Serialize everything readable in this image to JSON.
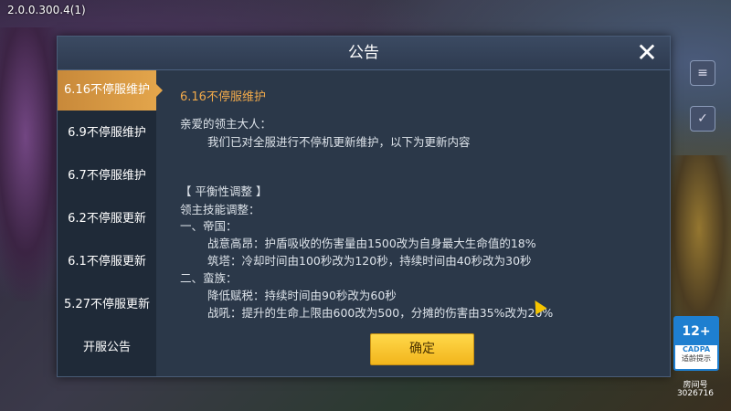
{
  "version": "2.0.0.300.4(1)",
  "dialog": {
    "title": "公告",
    "close_icon": "close-icon",
    "confirm_label": "确定"
  },
  "tabs": [
    {
      "label": "6.16不停服维护",
      "active": true
    },
    {
      "label": "6.9不停服维护",
      "active": false
    },
    {
      "label": "6.7不停服维护",
      "active": false
    },
    {
      "label": "6.2不停服更新",
      "active": false
    },
    {
      "label": "6.1不停服更新",
      "active": false
    },
    {
      "label": "5.27不停服更新",
      "active": false
    },
    {
      "label": "开服公告",
      "active": false
    }
  ],
  "content": {
    "title": "6.16不停服维护",
    "lines": [
      "亲爱的领主大人：",
      "我们已对全服进行不停机更新维护，以下为更新内容",
      "【 平衡性调整 】",
      "领主技能调整：",
      "一、帝国：",
      "战意高昂：护盾吸收的伤害量由1500改为自身最大生命值的18%",
      "筑塔：冷却时间由100秒改为120秒，持续时间由40秒改为30秒",
      "二、蛮族：",
      "降低赋税：持续时间由90秒改为60秒",
      "战吼：提升的生命上限由600改为500，分摊的伤害由35%改为20%"
    ]
  },
  "age_rating": {
    "rating": "12+",
    "org": "CADPA",
    "tip": "适龄提示"
  },
  "room": {
    "label": "房间号",
    "id": "3026716"
  },
  "colors": {
    "accent": "#e3a54b",
    "panel": "#2b3849",
    "title_text": "#f0a94a",
    "confirm": "#f2b51c"
  }
}
